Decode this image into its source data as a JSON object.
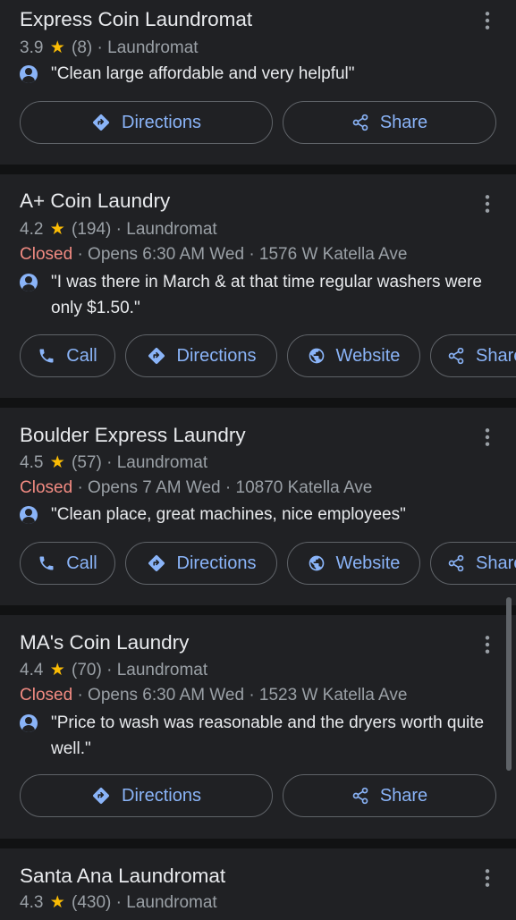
{
  "results": [
    {
      "name": "Express Coin Laundromat",
      "rating": "3.9",
      "reviews": "(8)",
      "category": "Laundromat",
      "review_text": "\"Clean large affordable and very helpful\"",
      "buttons": {
        "directions": "Directions",
        "share": "Share"
      }
    },
    {
      "name": "A+ Coin Laundry",
      "rating": "4.2",
      "reviews": "(194)",
      "category": "Laundromat",
      "status": "Closed",
      "hours": "Opens 6:30 AM Wed",
      "address": "1576 W Katella Ave",
      "review_text": "\"I was there in March & at that time regular washers were only $1.50.\"",
      "buttons": {
        "call": "Call",
        "directions": "Directions",
        "website": "Website",
        "share": "Share"
      }
    },
    {
      "name": "Boulder Express Laundry",
      "rating": "4.5",
      "reviews": "(57)",
      "category": "Laundromat",
      "status": "Closed",
      "hours": "Opens 7 AM Wed",
      "address": "10870 Katella Ave",
      "review_text": "\"Clean place, great machines, nice employees\"",
      "buttons": {
        "call": "Call",
        "directions": "Directions",
        "website": "Website",
        "share": "Share"
      }
    },
    {
      "name": "MA's Coin Laundry",
      "rating": "4.4",
      "reviews": "(70)",
      "category": "Laundromat",
      "status": "Closed",
      "hours": "Opens 6:30 AM Wed",
      "address": "1523 W Katella Ave",
      "review_text": "\"Price to wash was reasonable and the dryers worth quite well.\"",
      "buttons": {
        "directions": "Directions",
        "share": "Share"
      }
    },
    {
      "name": "Santa Ana Laundromat",
      "rating": "4.3",
      "reviews": "(430)",
      "category": "Laundromat"
    }
  ],
  "symbols": {
    "star": "★",
    "separator": "·"
  },
  "colors": {
    "accent": "#8ab4f8",
    "closed": "#f28b82",
    "star": "#fbbc04",
    "card": "#202124",
    "background": "#111213"
  },
  "icons": [
    "more-vert-icon",
    "directions-icon",
    "share-icon",
    "phone-icon",
    "globe-icon",
    "avatar-icon",
    "star-icon"
  ]
}
